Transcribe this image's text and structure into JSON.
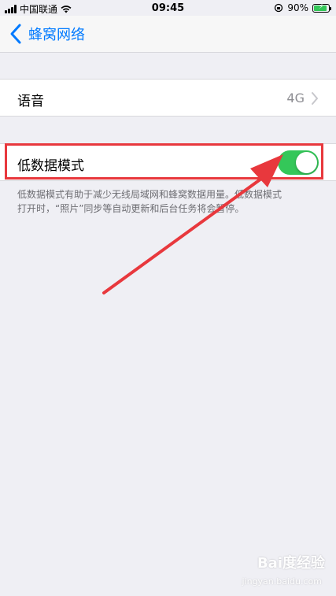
{
  "status_bar": {
    "carrier": "中国联通",
    "time": "09:45",
    "battery_percent": "90%"
  },
  "nav": {
    "back_label": "蜂窝网络"
  },
  "settings": {
    "voice": {
      "label": "语音",
      "value": "4G"
    },
    "low_data_mode": {
      "label": "低数据模式",
      "enabled": true
    }
  },
  "footer": {
    "line1": "低数据模式有助于减少无线局域网和蜂窝数据用量。低数据模式",
    "line2": "打开时，“照片”同步等自动更新和后台任务将会暂停。"
  },
  "colors": {
    "accent": "#007aff",
    "toggle_on": "#34c759",
    "highlight": "#e8383d"
  },
  "watermark": {
    "brand": "Bai度经验",
    "url": "jingyan.baidu.com"
  }
}
